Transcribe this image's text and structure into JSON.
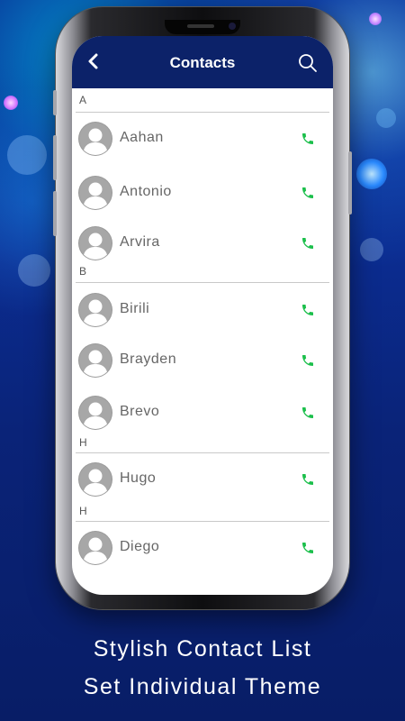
{
  "header": {
    "title": "Contacts"
  },
  "sections": [
    {
      "letter": "A",
      "contacts": [
        "Aahan",
        "Antonio",
        "Arvira"
      ]
    },
    {
      "letter": "B",
      "contacts": [
        "Birili",
        "Brayden",
        "Brevo"
      ]
    },
    {
      "letter": "H",
      "contacts": [
        "Hugo"
      ]
    },
    {
      "letter": "H",
      "contacts": [
        "Diego"
      ]
    }
  ],
  "tagline": {
    "line1": "Stylish Contact List",
    "line2": "Set Individual Theme"
  },
  "colors": {
    "header_bg": "#0c2269",
    "call_icon": "#1bbf4b",
    "background": "#0a2378"
  },
  "icons": {
    "back": "chevron-left-icon",
    "search": "search-icon",
    "call": "phone-icon",
    "avatar": "person-silhouette-icon"
  }
}
